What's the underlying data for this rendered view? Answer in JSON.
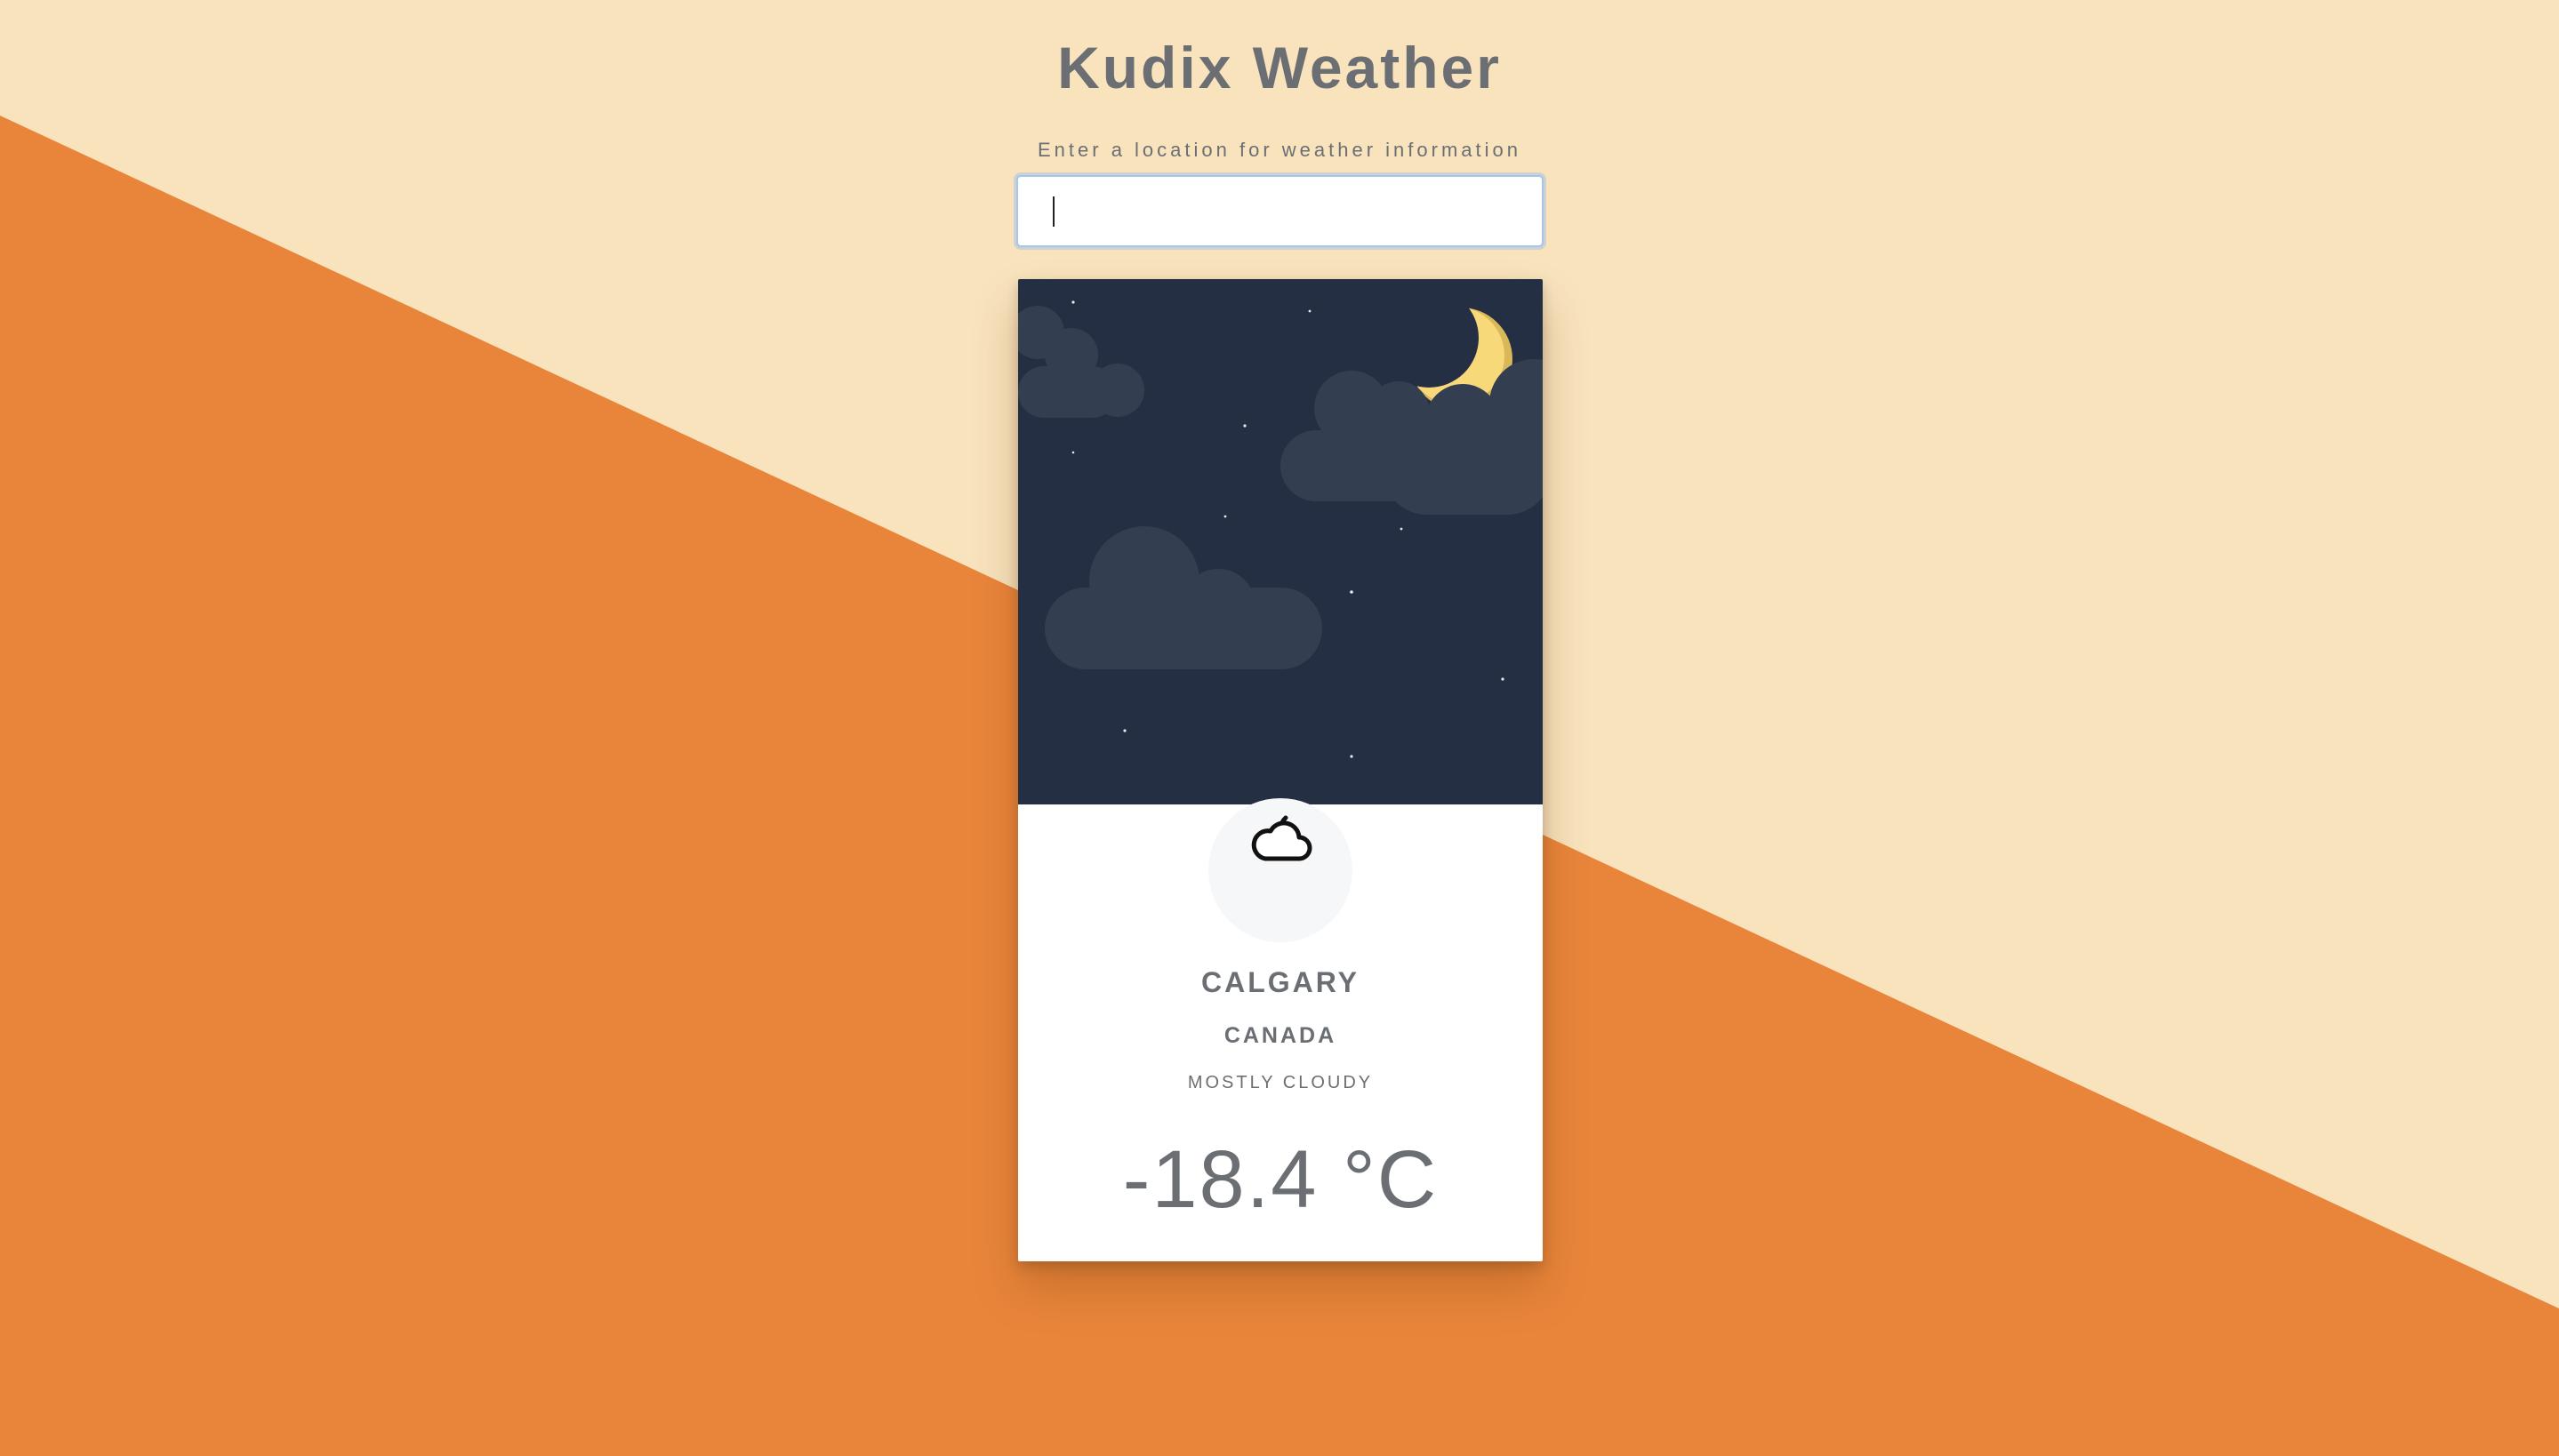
{
  "app": {
    "title": "Kudix Weather"
  },
  "search": {
    "label": "Enter a location for weather information",
    "value": "",
    "placeholder": ""
  },
  "weather": {
    "city": "CALGARY",
    "country": "CANADA",
    "condition": "MOSTLY CLOUDY",
    "temperature": "-18.4 °C",
    "condition_icon": "partly-cloudy-night-icon",
    "time_of_day": "night"
  },
  "colors": {
    "background_light": "#f8e3bd",
    "background_accent": "#e9853b",
    "night_sky": "#252f44",
    "cloud": "#343e51",
    "moon": "#f7d97a",
    "text": "#6b6f73",
    "input_focus": "#a8c4e6"
  }
}
